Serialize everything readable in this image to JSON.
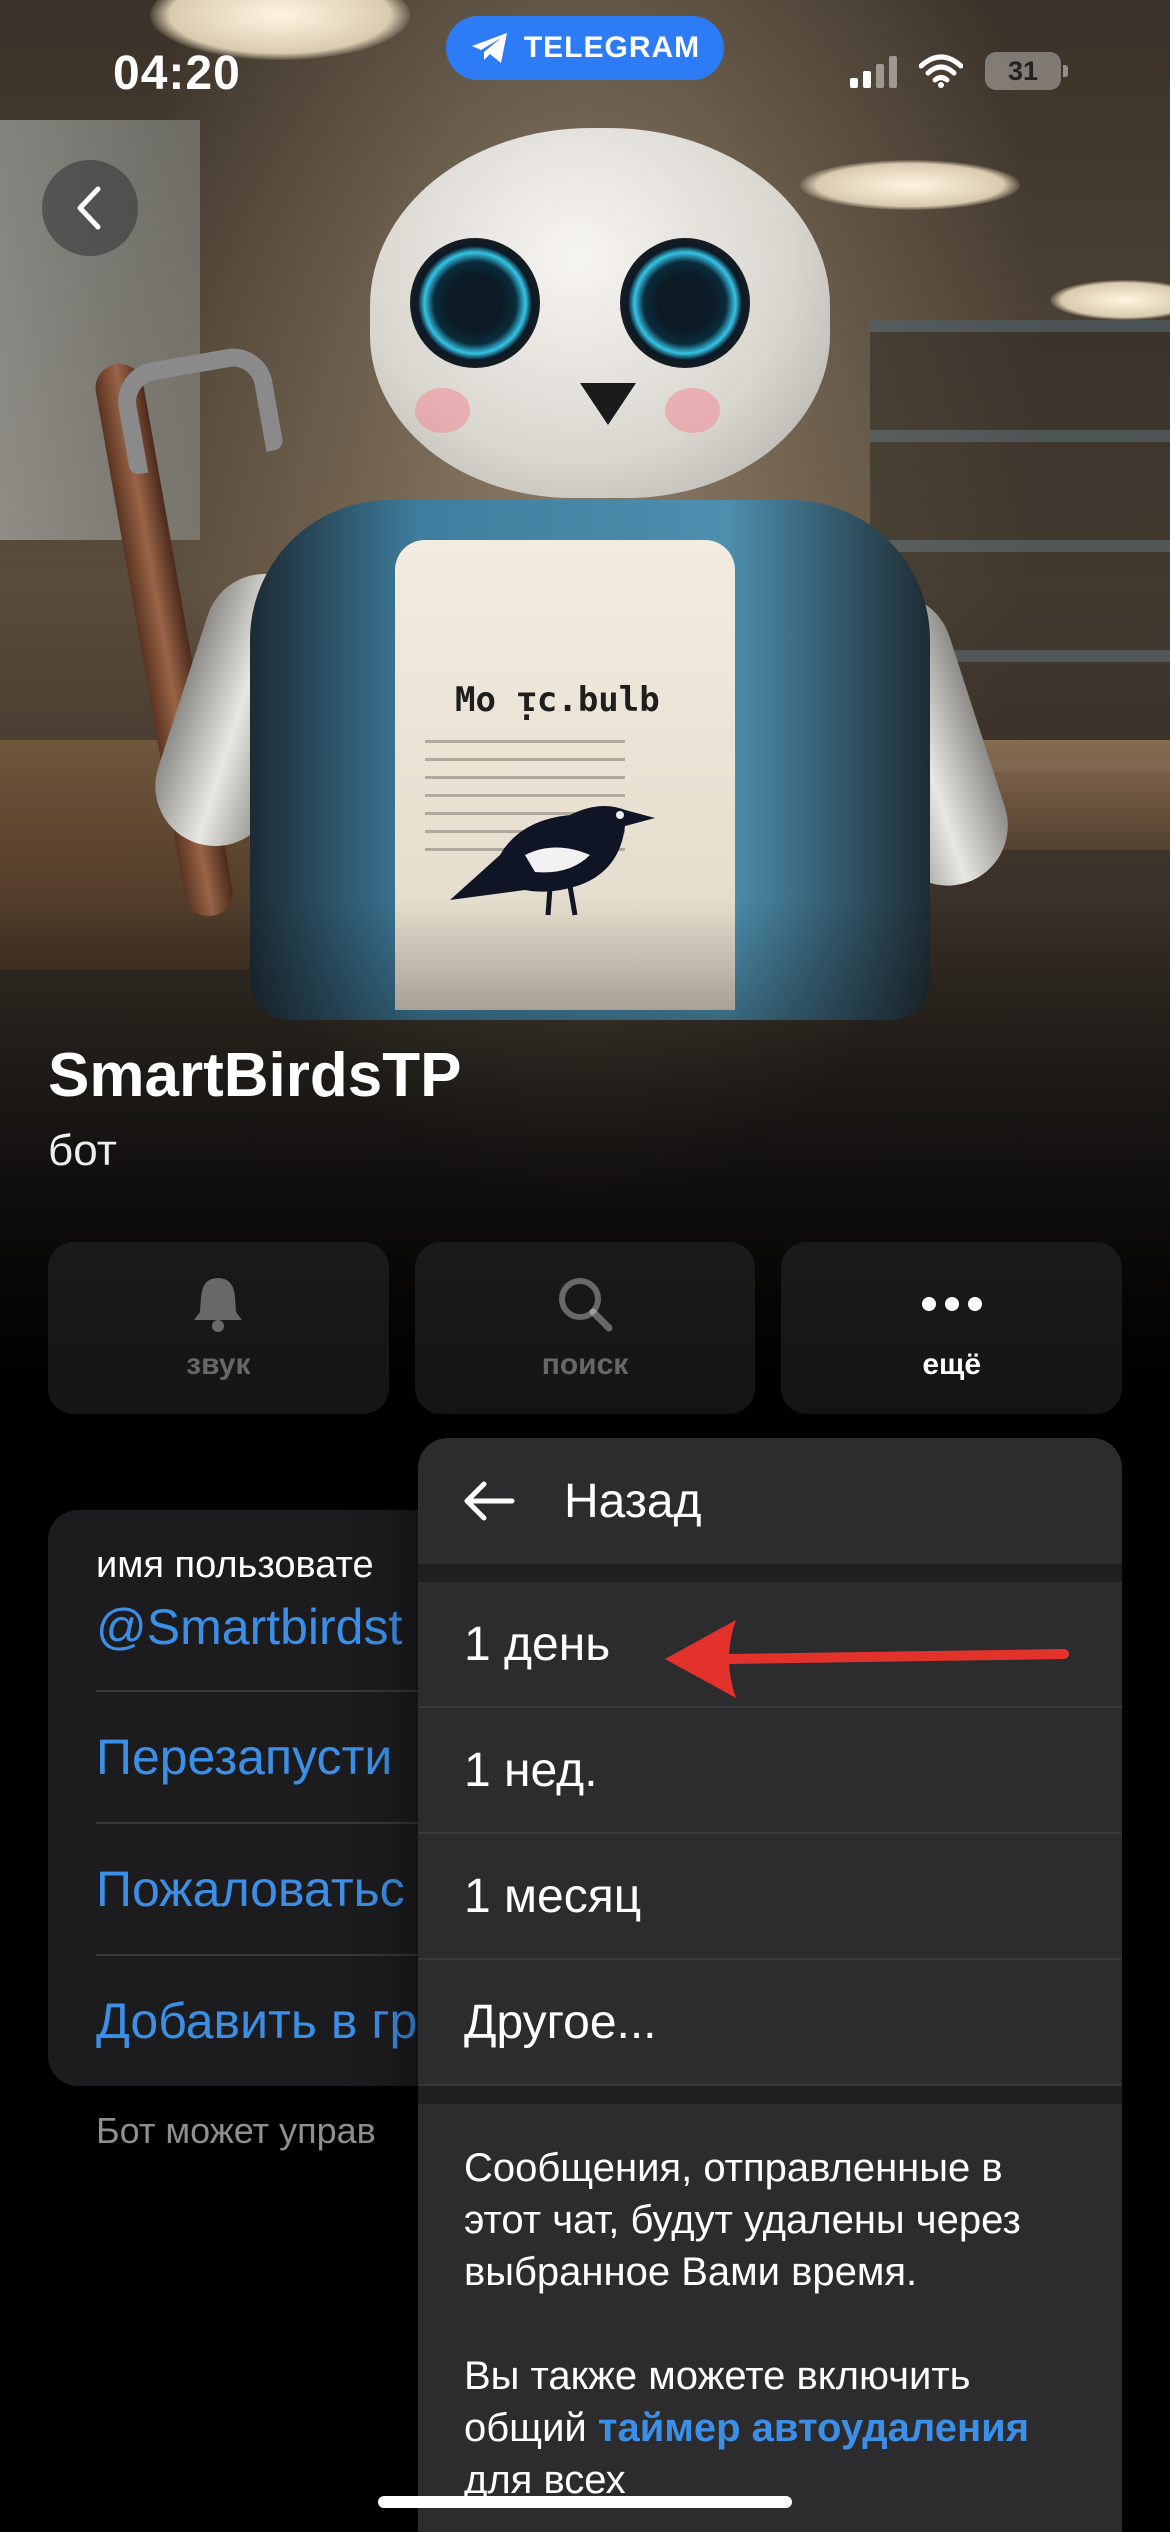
{
  "status_bar": {
    "time": "04:20",
    "telegram_pill": "TELEGRAM",
    "battery": "31"
  },
  "profile": {
    "name": "SmartBirdsTP",
    "type": "бот",
    "apron_text": "Mo ᴉc.bulb"
  },
  "actions": [
    {
      "label": "звук",
      "icon": "bell-icon"
    },
    {
      "label": "поиск",
      "icon": "search-icon"
    },
    {
      "label": "ещё",
      "icon": "more-icon"
    }
  ],
  "info": {
    "username_label": "имя пользовате",
    "username": "@Smartbirdst",
    "rows": [
      "Перезапусти",
      "Пожаловатьс",
      "Добавить в гр"
    ],
    "footnote": "Бот может управ"
  },
  "menu": {
    "back_label": "Назад",
    "items": [
      "1 день",
      "1 нед.",
      "1 месяц",
      "Другое..."
    ],
    "info_p1": "Сообщения, отправленные в этот чат, будут удалены через выбранное Вами время.",
    "info_p2_prefix": "Вы также можете включить общий ",
    "info_p2_link": "таймер автоудаления",
    "info_p2_suffix": " для всех"
  },
  "colors": {
    "accent": "#3c8fe6",
    "telegram_blue": "#2d7cf6",
    "annotation_arrow": "#e3322b"
  }
}
